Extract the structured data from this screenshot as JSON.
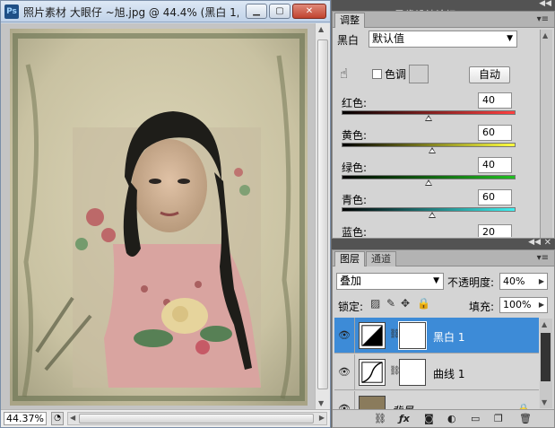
{
  "document": {
    "app_icon": "Ps",
    "title": "照片素材 大眼仔 ~旭.jpg @ 44.4% (黑白 1,...",
    "zoom": "44.37%"
  },
  "watermark": "思缘设计论坛 www.MISSYUAN.COM",
  "adjustments": {
    "tab_label": "调整",
    "type_label": "黑白",
    "preset": "默认值",
    "tint_label": "色调",
    "auto_label": "自动",
    "sliders": [
      {
        "label": "红色:",
        "value": "40",
        "level": 0.5,
        "from": "#000000",
        "to": "#ff4040"
      },
      {
        "label": "黄色:",
        "value": "60",
        "level": 0.52,
        "from": "#000000",
        "to": "#ffff40"
      },
      {
        "label": "绿色:",
        "value": "40",
        "level": 0.5,
        "from": "#000000",
        "to": "#20c020"
      },
      {
        "label": "青色:",
        "value": "60",
        "level": 0.52,
        "from": "#000000",
        "to": "#40f0f0"
      },
      {
        "label": "蓝色:",
        "value": "20",
        "level": null,
        "from": "#000000",
        "to": "#4040ff"
      }
    ]
  },
  "layers": {
    "tabs": [
      "图层",
      "通道"
    ],
    "blend_mode": "叠加",
    "opacity_label": "不透明度:",
    "opacity": "40%",
    "lock_label": "锁定:",
    "fill_label": "填充:",
    "fill": "100%",
    "items": [
      {
        "name": "黑白 1",
        "selected": true
      },
      {
        "name": "曲线 1",
        "selected": false
      },
      {
        "name": "背景",
        "selected": false
      }
    ]
  },
  "colors": {
    "selection": "#3d8bd7",
    "panel_bg": "#d4d4d4"
  }
}
